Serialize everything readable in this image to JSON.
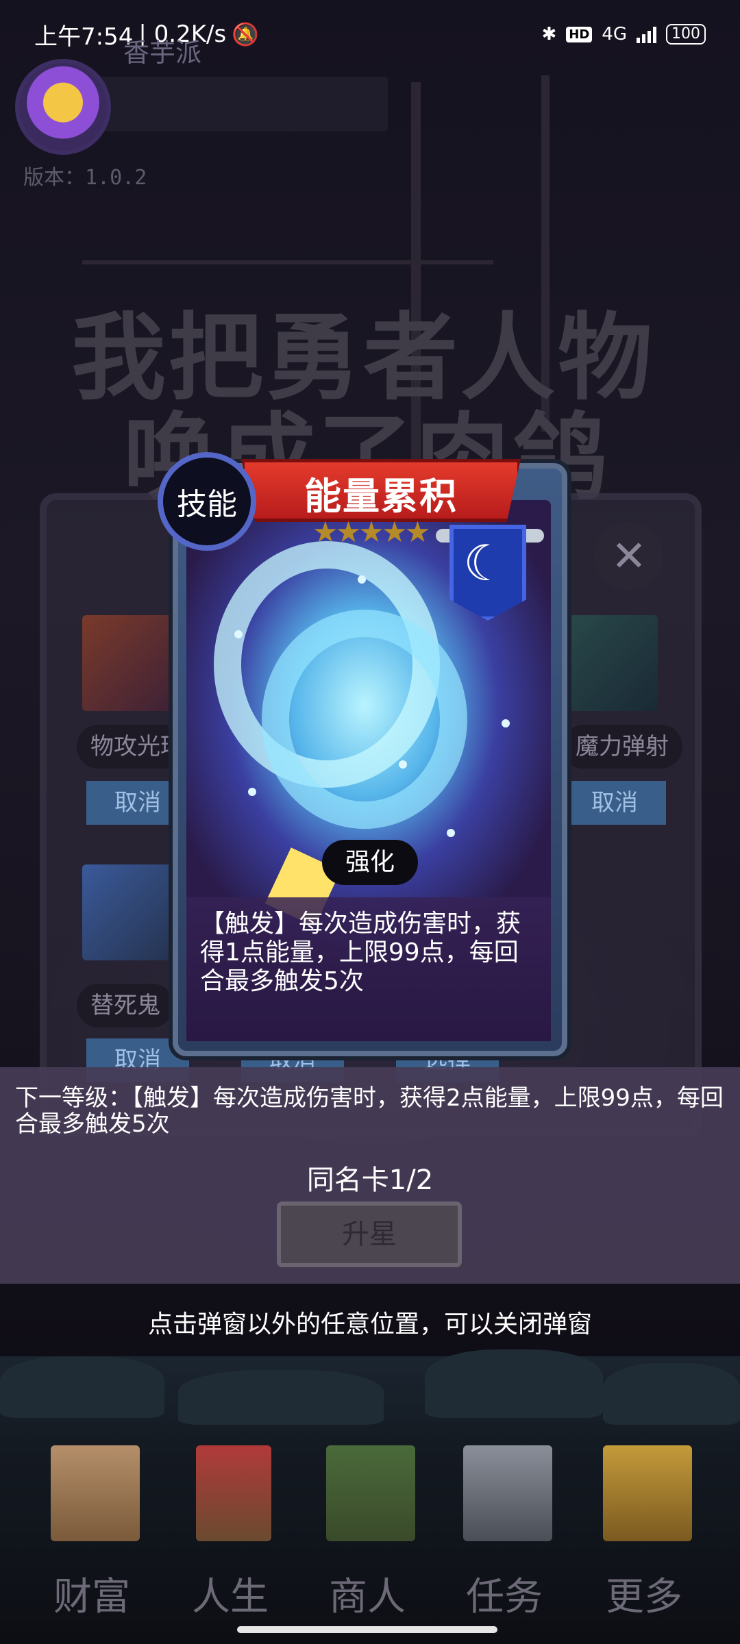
{
  "status_bar": {
    "time": "上午7:54",
    "speed": "| 0.2K/s",
    "network": "4G",
    "hd": "HD",
    "battery": "100"
  },
  "profile": {
    "username": "香芋派",
    "version": "版本：1.0.2"
  },
  "game_title": {
    "line1": "我把勇者人物",
    "line2": "唤成了肉鸽"
  },
  "background_dialog": {
    "cards": [
      {
        "label": "物攻光环",
        "button": "取消"
      },
      {
        "label": "魔力弹射",
        "button": "取消"
      },
      {
        "label": "替死鬼",
        "button": "取消"
      }
    ],
    "hidden_buttons": [
      "取消",
      "选择"
    ],
    "close_icon": "close-icon"
  },
  "card": {
    "type_badge": "技能",
    "name": "能量累积",
    "stars": "★★★★★",
    "element_icon": "moon-icon",
    "enhance_label": "强化",
    "description": "【触发】每次造成伤害时，获得1点能量，上限99点，每回合最多触发5次"
  },
  "upgrade_panel": {
    "next_level": "下一等级：【触发】每次造成伤害时，获得2点能量，上限99点，每回合最多触发5次",
    "same_card": "同名卡1/2",
    "upgrade_button": "升星",
    "dim_hint": "点击弹窗以外的任意位置，可以关闭弹窗"
  },
  "close_hint": "点击弹窗以外的任意位置，可以关闭弹窗",
  "nav": {
    "items": [
      {
        "label": "财富",
        "icon": "castle-icon"
      },
      {
        "label": "人生",
        "icon": "tower-icon"
      },
      {
        "label": "商人",
        "icon": "merchant-tent-icon"
      },
      {
        "label": "任务",
        "icon": "quest-monument-icon"
      },
      {
        "label": "更多",
        "icon": "more-building-icon"
      }
    ]
  },
  "colors": {
    "banner_red": "#d9302a",
    "badge_blue": "#5466c7",
    "button_blue": "#3a5e8a"
  }
}
